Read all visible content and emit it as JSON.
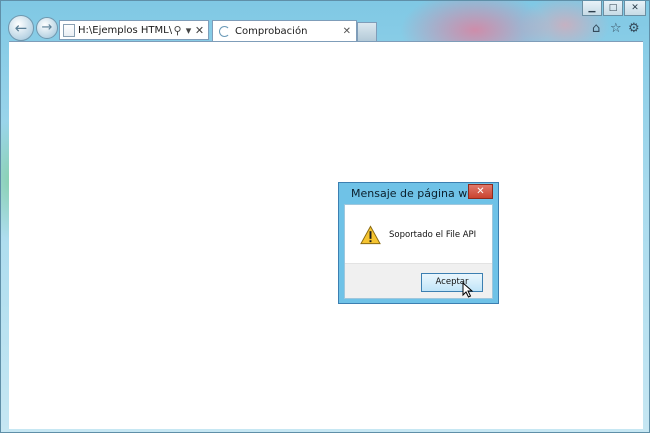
{
  "window": {
    "caption_buttons": {
      "minimize": "▁",
      "maximize": "□",
      "close": "✕"
    }
  },
  "toolbar": {
    "back_icon": "←",
    "forward_icon": "→",
    "address": "H:\\Ejemplos HTML\\Reac",
    "search_icon": "⚲",
    "dropdown_icon": "▾",
    "refresh_icon": "✕",
    "home_icon": "⌂",
    "favorites_icon": "☆",
    "tools_icon": "⚙"
  },
  "tab": {
    "title": "Comprobación",
    "close": "✕"
  },
  "dialog": {
    "title": "Mensaje de página web",
    "close": "✕",
    "message": "Soportado el File API",
    "ok_label": "Aceptar"
  }
}
